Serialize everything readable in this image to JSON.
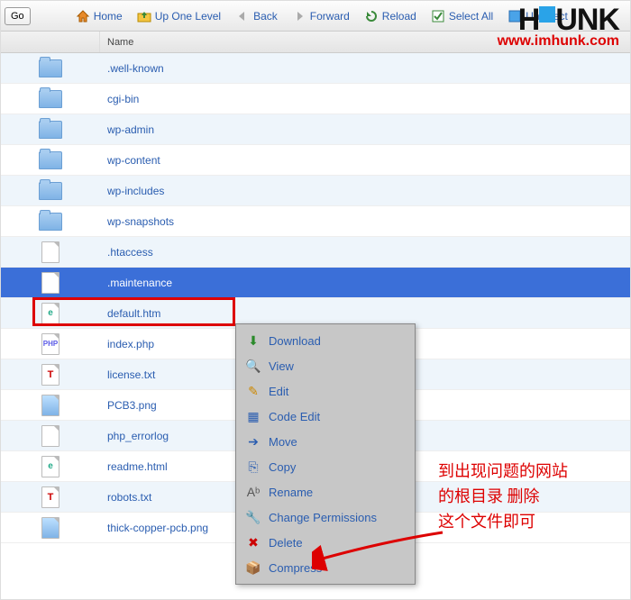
{
  "toolbar": {
    "go": "Go",
    "home": "Home",
    "up": "Up One Level",
    "back": "Back",
    "forward": "Forward",
    "reload": "Reload",
    "select_all": "Select All",
    "unselect": "Unselect"
  },
  "columns": {
    "name": "Name"
  },
  "files": [
    {
      "name": ".well-known",
      "type": "folder"
    },
    {
      "name": "cgi-bin",
      "type": "folder"
    },
    {
      "name": "wp-admin",
      "type": "folder"
    },
    {
      "name": "wp-content",
      "type": "folder"
    },
    {
      "name": "wp-includes",
      "type": "folder"
    },
    {
      "name": "wp-snapshots",
      "type": "folder"
    },
    {
      "name": ".htaccess",
      "type": "file-text"
    },
    {
      "name": ".maintenance",
      "type": "file-text",
      "selected": true
    },
    {
      "name": "default.htm",
      "type": "file-e"
    },
    {
      "name": "index.php",
      "type": "file-php"
    },
    {
      "name": "license.txt",
      "type": "file-t"
    },
    {
      "name": "PCB3.png",
      "type": "file-png"
    },
    {
      "name": "php_errorlog",
      "type": "file-text"
    },
    {
      "name": "readme.html",
      "type": "file-e"
    },
    {
      "name": "robots.txt",
      "type": "file-t"
    },
    {
      "name": "thick-copper-pcb.png",
      "type": "file-png"
    }
  ],
  "context_menu": [
    {
      "label": "Download",
      "icon": "download-icon",
      "glyph": "⬇",
      "color": "#2a8a2a"
    },
    {
      "label": "View",
      "icon": "view-icon",
      "glyph": "🔍",
      "color": "#2a5db0"
    },
    {
      "label": "Edit",
      "icon": "edit-icon",
      "glyph": "✎",
      "color": "#c80"
    },
    {
      "label": "Code Edit",
      "icon": "code-edit-icon",
      "glyph": "▦",
      "color": "#2a5db0"
    },
    {
      "label": "Move",
      "icon": "move-icon",
      "glyph": "➔",
      "color": "#2a5db0"
    },
    {
      "label": "Copy",
      "icon": "copy-icon",
      "glyph": "⎘",
      "color": "#2a5db0"
    },
    {
      "label": "Rename",
      "icon": "rename-icon",
      "glyph": "Aᵇ",
      "color": "#555"
    },
    {
      "label": "Change Permissions",
      "icon": "permissions-icon",
      "glyph": "🔧",
      "color": "#c80"
    },
    {
      "label": "Delete",
      "icon": "delete-icon",
      "glyph": "✖",
      "color": "#c00"
    },
    {
      "label": "Compress",
      "icon": "compress-icon",
      "glyph": "📦",
      "color": "#a66"
    }
  ],
  "annotation": {
    "line1": "到出现问题的网站",
    "line2": "的根目录 删除",
    "line3": "这个文件即可"
  },
  "watermark": {
    "brand_h": "H",
    "brand_rest": "UNK",
    "url": "www.imhunk.com"
  }
}
